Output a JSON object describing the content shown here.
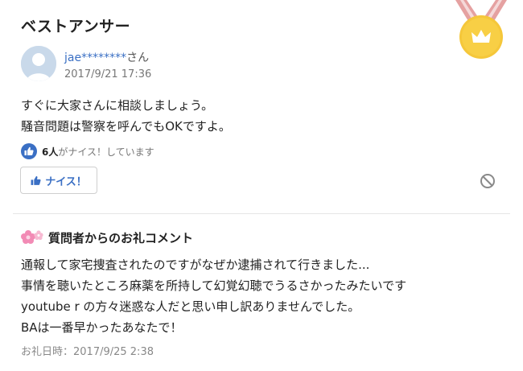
{
  "section_title": "ベストアンサー",
  "user": {
    "name": "jae********",
    "suffix": "さん",
    "date": "2017/9/21 17:36"
  },
  "answer_lines": [
    "すぐに大家さんに相談しましょう。",
    "騒音問題は警察を呼んでもOKですよ。"
  ],
  "likes": {
    "count": "6人",
    "text": "がナイス！しています"
  },
  "nice_button_label": "ナイス！",
  "thanks": {
    "heading": "質問者からのお礼コメント",
    "lines": [
      "通報して家宅捜査されたのですがなぜか逮捕されて行きました...",
      "事情を聴いたところ麻薬を所持して幻覚幻聴でうるさかったみたいです",
      "youtube r の方々迷惑な人だと思い申し訳ありませんでした。",
      "BAは一番早かったあなたで！"
    ],
    "date": "お礼日時：2017/9/25 2:38"
  },
  "colors": {
    "accent": "#3a6fc4",
    "medal_gold": "#f5c73a",
    "ribbon": "#e07f7f"
  },
  "icons": [
    "medal-icon",
    "avatar",
    "thumbs-up-icon",
    "report-icon",
    "flower-icon"
  ]
}
